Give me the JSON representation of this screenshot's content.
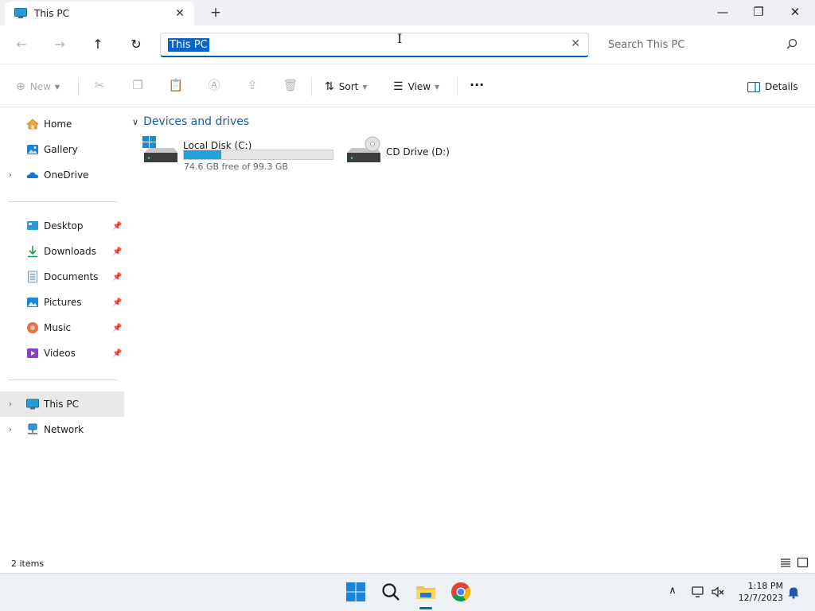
{
  "window": {
    "tab_title": "This PC",
    "tab_close": "✕",
    "new_tab": "+",
    "minimize": "—",
    "restore": "❐",
    "close": "✕"
  },
  "nav": {
    "back": "←",
    "forward": "→",
    "up": "↑",
    "refresh": "↻"
  },
  "address": {
    "value": "This PC",
    "clear": "✕"
  },
  "search": {
    "placeholder": "Search This PC"
  },
  "commands": {
    "new_label": "New",
    "sort_label": "Sort",
    "view_label": "View",
    "more": "···",
    "details_label": "Details"
  },
  "sidebar": {
    "quick": [
      {
        "label": "Home",
        "icon": "home-icon"
      },
      {
        "label": "Gallery",
        "icon": "gallery-icon"
      },
      {
        "label": "OneDrive",
        "icon": "onedrive-icon"
      }
    ],
    "pinned": [
      {
        "label": "Desktop",
        "icon": "desktop-icon"
      },
      {
        "label": "Downloads",
        "icon": "downloads-icon"
      },
      {
        "label": "Documents",
        "icon": "documents-icon"
      },
      {
        "label": "Pictures",
        "icon": "pictures-icon"
      },
      {
        "label": "Music",
        "icon": "music-icon"
      },
      {
        "label": "Videos",
        "icon": "videos-icon"
      }
    ],
    "locations": [
      {
        "label": "This PC",
        "icon": "this-pc-icon",
        "selected": true
      },
      {
        "label": "Network",
        "icon": "network-icon"
      }
    ]
  },
  "content": {
    "group_title": "Devices and drives",
    "drives": [
      {
        "name": "Local Disk (C:)",
        "free_text": "74.6 GB free of 99.3 GB",
        "used_fraction": 0.25
      },
      {
        "name": "CD Drive (D:)"
      }
    ]
  },
  "status": {
    "item_count": "2 items"
  },
  "taskbar": {
    "time": "1:18 PM",
    "date": "12/7/2023"
  },
  "colors": {
    "accent": "#005fb8",
    "selection": "#0a64c8",
    "drive_bar": "#26a0da",
    "group_title": "#1a5aa6"
  }
}
